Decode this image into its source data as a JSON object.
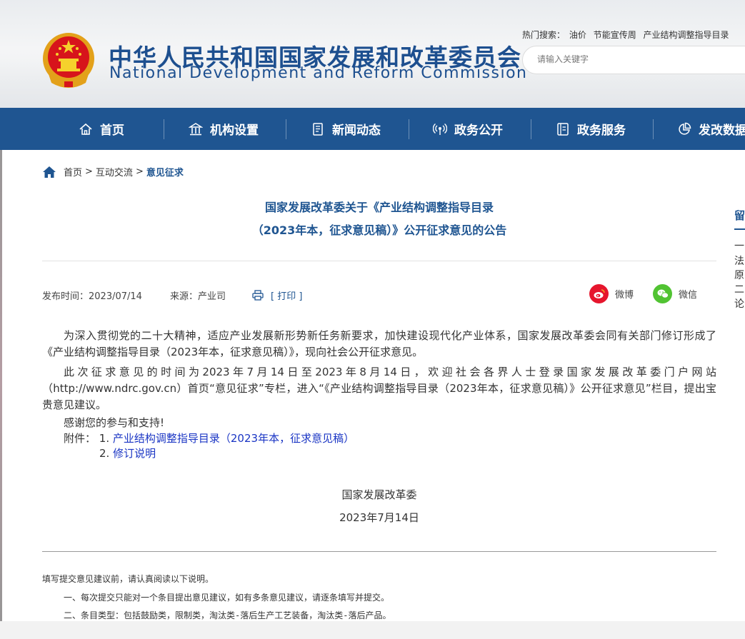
{
  "header": {
    "title_cn": "中华人民共和国国家发展和改革委员会",
    "title_en": "National Development and Reform Commission",
    "hot_label": "热门搜索：",
    "hot_items": [
      "油价",
      "节能宣传周",
      "产业结构调整指导目录"
    ],
    "search_placeholder": "请输入关键字"
  },
  "nav": {
    "items": [
      {
        "label": "首页",
        "icon": "home-icon"
      },
      {
        "label": "机构设置",
        "icon": "building-icon"
      },
      {
        "label": "新闻动态",
        "icon": "news-icon"
      },
      {
        "label": "政务公开",
        "icon": "broadcast-icon"
      },
      {
        "label": "政务服务",
        "icon": "document-icon"
      },
      {
        "label": "发改数据",
        "icon": "pie-chart-icon"
      }
    ]
  },
  "breadcrumb": {
    "items": [
      "首页",
      "互动交流",
      "意见征求"
    ],
    "separator": ">"
  },
  "article": {
    "title_line1": "国家发展改革委关于《产业结构调整指导目录",
    "title_line2": "（2023年本，征求意见稿）》公开征求意见的公告",
    "publish_label": "发布时间：",
    "publish_date": "2023/07/14",
    "source_label": "来源：",
    "source": "产业司",
    "print_label": "[ 打印 ]",
    "share_weibo": "微博",
    "share_wechat": "微信",
    "p1": "为深入贯彻党的二十大精神，适应产业发展新形势新任务新要求，加快建设现代化产业体系，国家发展改革委会同有关部门修订形成了《产业结构调整指导目录（2023年本，征求意见稿）》，现向社会公开征求意见。",
    "p2": "此次征求意见的时间为2023年7月14日至2023年8月14日，欢迎社会各界人士登录国家发展改革委门户网站（http://www.ndrc.gov.cn）首页“意见征求”专栏，进入“《产业结构调整指导目录（2023年本，征求意见稿）》公开征求意见”栏目，提出宝贵意见建议。",
    "p3": "感谢您的参与和支持!",
    "attach_label": "附件：",
    "attach1_num": "1.",
    "attach1": "产业结构调整指导目录（2023年本，征求意见稿）",
    "attach2_num": "2.",
    "attach2": "修订说明",
    "sign_org": "国家发展改革委",
    "sign_date": "2023年7月14日"
  },
  "notes": {
    "n1": "填写提交意见建议前，请认真阅读以下说明。",
    "n2": "一、每次提交只能对一个条目提出意见建议，如有多条意见建议，请逐条填写并提交。",
    "n3": "二、条目类型：包括鼓励类，限制类，淘汰类-落后生产工艺装备，淘汰类-落后产品。"
  },
  "sidebar_peek": [
    "留",
    "一",
    "法",
    "原",
    "二",
    "论"
  ],
  "colors": {
    "brand_blue": "#1f5591",
    "link_blue": "#1a35c4",
    "weibo_red": "#e6162d",
    "wechat_green": "#51c332"
  }
}
